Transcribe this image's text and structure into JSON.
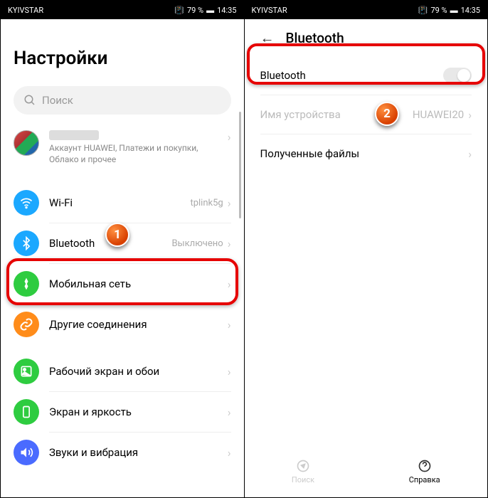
{
  "statusbar": {
    "carrier": "KYIVSTAR",
    "battery": "79 %",
    "time": "14:35"
  },
  "left": {
    "title": "Настройки",
    "search_placeholder": "Поиск",
    "account_sub": "Аккаунт HUAWEI, Платежи и покупки, Облако и прочее",
    "items": {
      "wifi": {
        "label": "Wi-Fi",
        "value": "tplink5g"
      },
      "bluetooth": {
        "label": "Bluetooth",
        "value": "Выключено"
      },
      "mobile": {
        "label": "Мобильная сеть"
      },
      "other": {
        "label": "Другие соединения"
      },
      "wallpaper": {
        "label": "Рабочий экран и обои"
      },
      "display": {
        "label": "Экран и яркость"
      },
      "sound": {
        "label": "Звуки и вибрация"
      }
    }
  },
  "right": {
    "title": "Bluetooth",
    "toggle_label": "Bluetooth",
    "device_name_label": "Имя устройства",
    "device_name_value": "HUAWEI20",
    "received_label": "Полученные файлы",
    "bottom": {
      "search": "Поиск",
      "help": "Справка"
    }
  },
  "markers": {
    "m1": "1",
    "m2": "2"
  },
  "colors": {
    "wifi": "#1ba8ff",
    "bt": "#1ba8ff",
    "mobile": "#2ecc40",
    "other": "#ff8c1a",
    "wallpaper": "#2ecc40",
    "display": "#2ecc40",
    "sound": "#4a6bff"
  }
}
